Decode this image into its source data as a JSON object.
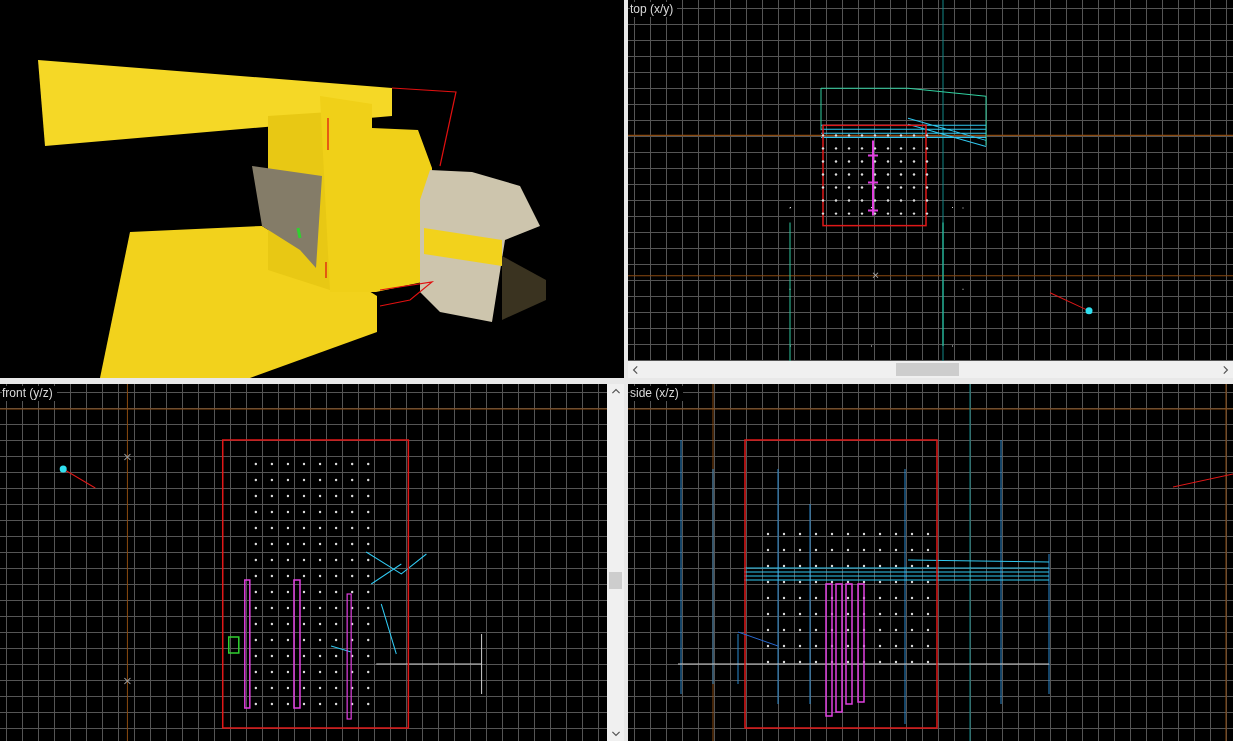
{
  "viewports": [
    {
      "kind": "camera"
    },
    {
      "kind": "top",
      "label": "top (x/y)",
      "horizontal_scrollbar": true,
      "vertical_scrollbar": false
    },
    {
      "kind": "front",
      "label": "front (y/z)",
      "horizontal_scrollbar": false,
      "vertical_scrollbar": true
    },
    {
      "kind": "side",
      "label": "side (x/z)",
      "horizontal_scrollbar": false,
      "vertical_scrollbar": false
    }
  ]
}
